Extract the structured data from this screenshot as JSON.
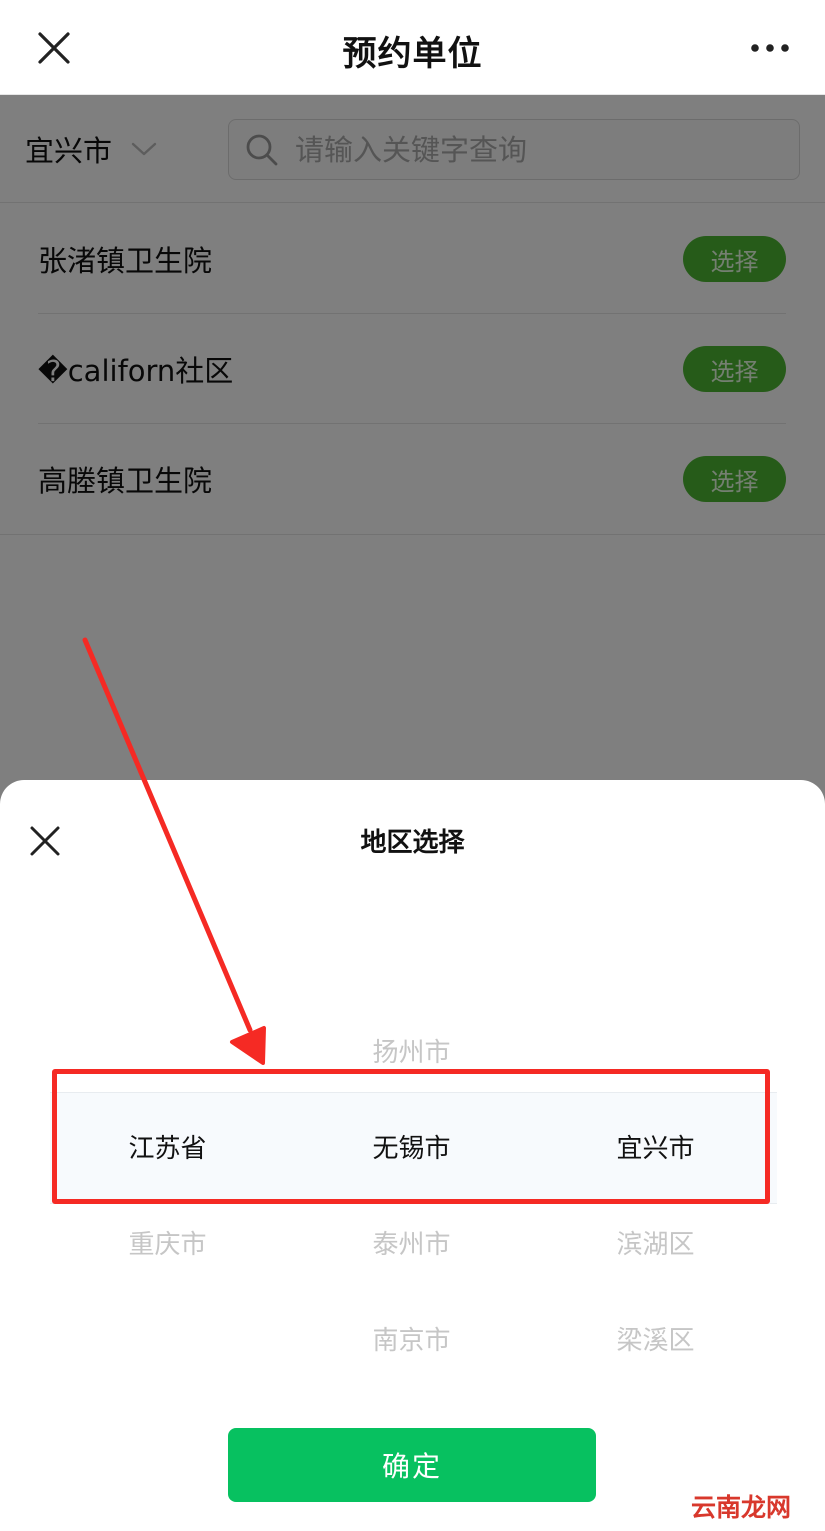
{
  "navbar": {
    "title": "预约单位",
    "close_icon": "close-icon",
    "more_icon": "more-dots-icon"
  },
  "filter": {
    "city": "宜兴市",
    "search_placeholder": "请输入关键字查询"
  },
  "units": [
    {
      "name": "张渚镇卫生院",
      "button": "选择"
    },
    {
      "name": "�californ社区",
      "button": "选择"
    },
    {
      "name": "高塍镇卫生院",
      "button": "选择"
    }
  ],
  "sheet": {
    "title": "地区选择",
    "confirm_label": "确定",
    "columns": [
      {
        "above": [],
        "selected": "江苏省",
        "below": [
          "重庆市"
        ]
      },
      {
        "above": [
          "扬州市"
        ],
        "selected": "无锡市",
        "below": [
          "泰州市",
          "南京市"
        ]
      },
      {
        "above": [],
        "selected": "宜兴市",
        "below": [
          "滨湖区",
          "梁溪区"
        ]
      }
    ]
  },
  "watermark": "云南龙网",
  "colors": {
    "accent_green": "#07c160",
    "select_green": "#4cb733",
    "annotation_red": "#f52a24"
  }
}
